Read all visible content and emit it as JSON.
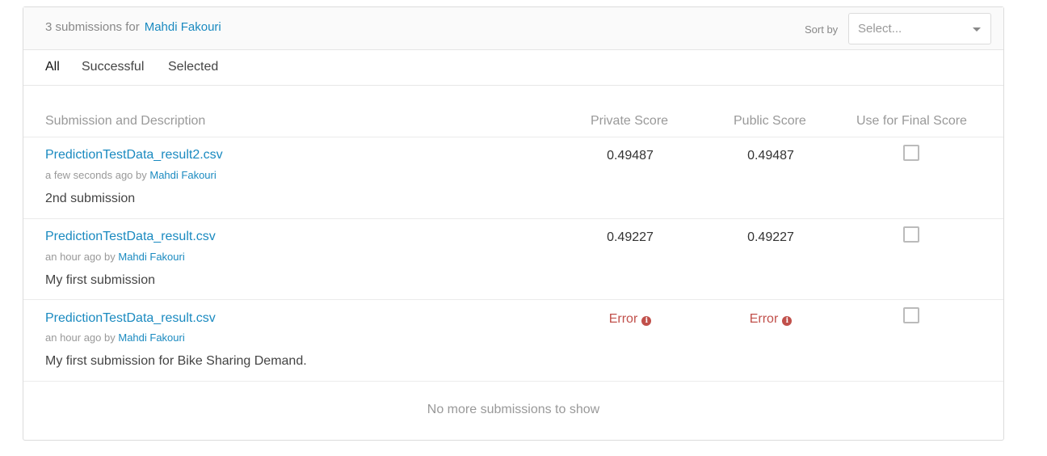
{
  "header": {
    "count_text": "3 submissions for",
    "user_name": "Mahdi Fakouri",
    "sort_label": "Sort by",
    "sort_placeholder": "Select..."
  },
  "tabs": [
    {
      "label": "All",
      "active": true
    },
    {
      "label": "Successful",
      "active": false
    },
    {
      "label": "Selected",
      "active": false
    }
  ],
  "columns": {
    "submission": "Submission and Description",
    "private": "Private Score",
    "public": "Public Score",
    "final": "Use for Final Score"
  },
  "submissions": [
    {
      "file": "PredictionTestData_result2.csv",
      "time": "a few seconds ago by",
      "user": "Mahdi Fakouri",
      "description": "2nd submission",
      "private_score": "0.49487",
      "public_score": "0.49487",
      "checked": false
    },
    {
      "file": "PredictionTestData_result.csv",
      "time": "an hour ago by",
      "user": "Mahdi Fakouri",
      "description": "My first submission",
      "private_score": "0.49227",
      "public_score": "0.49227",
      "checked": false
    },
    {
      "file": "PredictionTestData_result.csv",
      "time": "an hour ago by",
      "user": "Mahdi Fakouri",
      "description": "My first submission for Bike Sharing Demand.",
      "private_score": "Error",
      "public_score": "Error",
      "checked": false
    }
  ],
  "footer": "No more submissions to show",
  "colors": {
    "link": "#1a8ac0",
    "error": "#c1504b"
  }
}
